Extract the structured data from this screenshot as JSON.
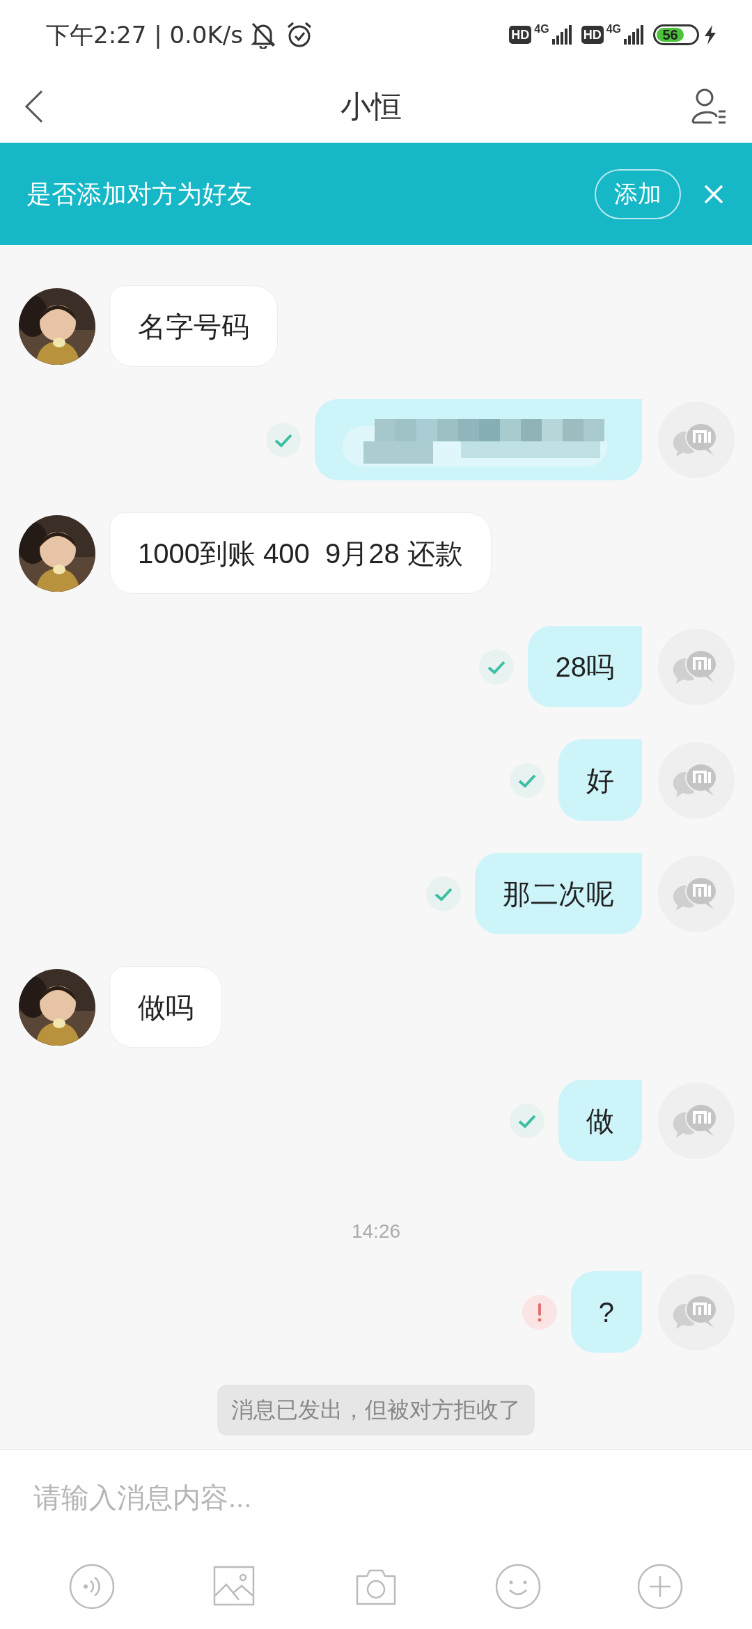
{
  "status_bar": {
    "time": "下午2:27 | 0.0K/s",
    "sims": [
      {
        "badge": "HD",
        "network": "4G"
      },
      {
        "badge": "HD",
        "network": "4G"
      }
    ],
    "battery": "56"
  },
  "header": {
    "title": "小恒"
  },
  "banner": {
    "text": "是否添加对方为好友",
    "button": "添加"
  },
  "messages": [
    {
      "kind": "text",
      "outgoing": false,
      "text": "名字号码"
    },
    {
      "kind": "mosaic",
      "outgoing": true,
      "failed": false
    },
    {
      "kind": "text",
      "outgoing": false,
      "text": "1000到账 400  9月28 还款"
    },
    {
      "kind": "text",
      "outgoing": true,
      "text": "28吗",
      "failed": false
    },
    {
      "kind": "text",
      "outgoing": true,
      "text": "好",
      "failed": false
    },
    {
      "kind": "text",
      "outgoing": true,
      "text": "那二次呢",
      "failed": false
    },
    {
      "kind": "text",
      "outgoing": false,
      "text": "做吗"
    },
    {
      "kind": "text",
      "outgoing": true,
      "text": "做",
      "failed": false
    },
    {
      "kind": "time",
      "text": "14:26"
    },
    {
      "kind": "text",
      "outgoing": true,
      "text": "?",
      "failed": true
    },
    {
      "kind": "notice",
      "text": "消息已发出，但被对方拒收了"
    }
  ],
  "composer": {
    "placeholder": "请输入消息内容..."
  }
}
